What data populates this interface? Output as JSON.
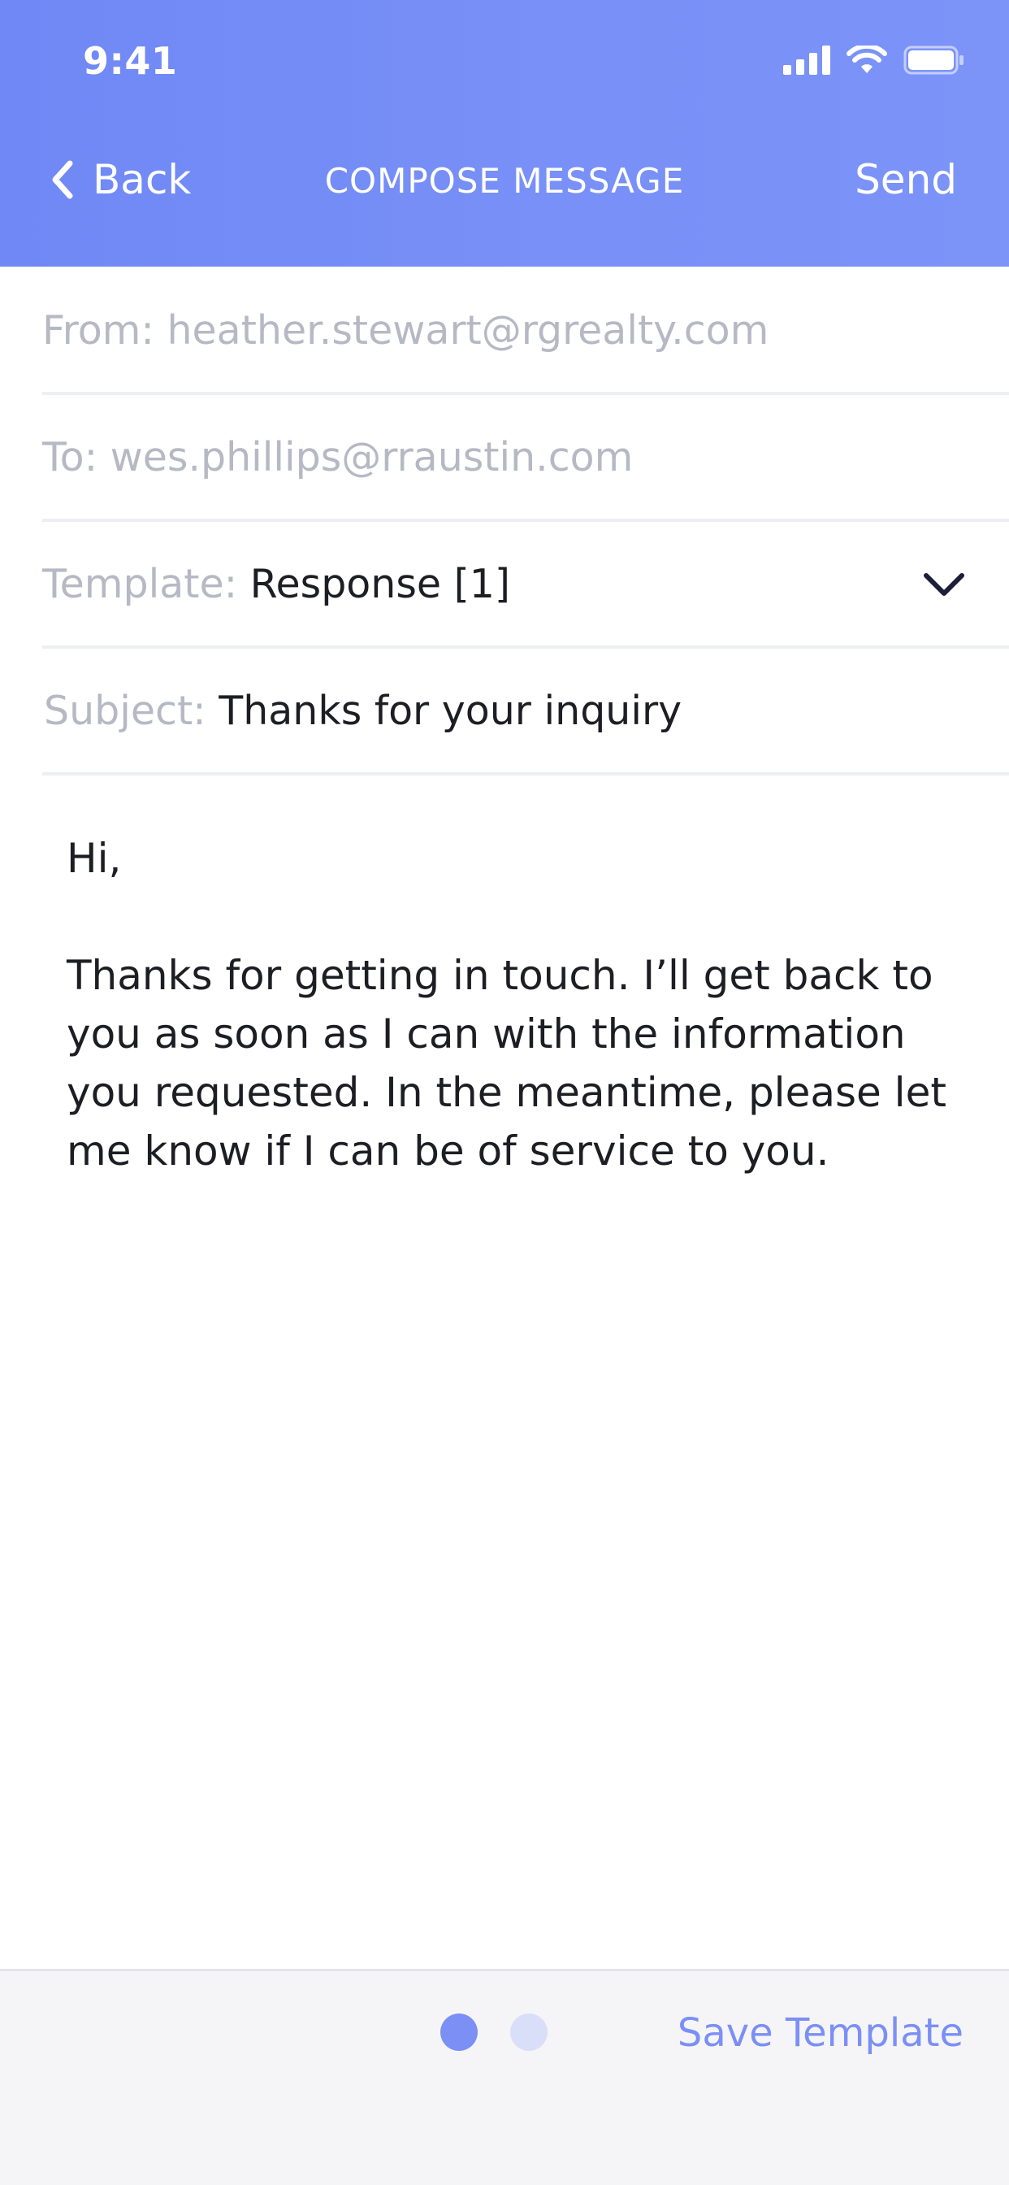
{
  "status_bar": {
    "time": "9:41"
  },
  "nav": {
    "back_label": "Back",
    "title": "COMPOSE MESSAGE",
    "send_label": "Send"
  },
  "form": {
    "from_label": "From: ",
    "from_value": "heather.stewart@rgrealty.com",
    "to_label": "To: ",
    "to_value": "wes.phillips@rraustin.com",
    "template_label": "Template: ",
    "template_value": "Response [1]",
    "subject_label": "Subject: ",
    "subject_value": "Thanks for your inquiry"
  },
  "message": {
    "greeting": "Hi,",
    "paragraph": "Thanks for getting in touch. I’ll get back to you as soon as I can with the information you requested. In the meantime, please let me know if I can be of service to you."
  },
  "footer": {
    "save_template_label": "Save Template",
    "page_indicator": {
      "current": 1,
      "total": 2
    }
  },
  "icons": {
    "back": "chevron-left-icon",
    "template_dropdown": "chevron-down-icon",
    "signal": "cellular-signal-icon",
    "wifi": "wifi-icon",
    "battery": "battery-icon"
  },
  "colors": {
    "header_gradient_start": "#6f88f5",
    "header_gradient_end": "#7c94f8",
    "accent": "#7b8ff5",
    "label_gray": "#b6b9c4",
    "text_dark": "#1d1e24",
    "footer_bg": "#f5f5f7"
  }
}
